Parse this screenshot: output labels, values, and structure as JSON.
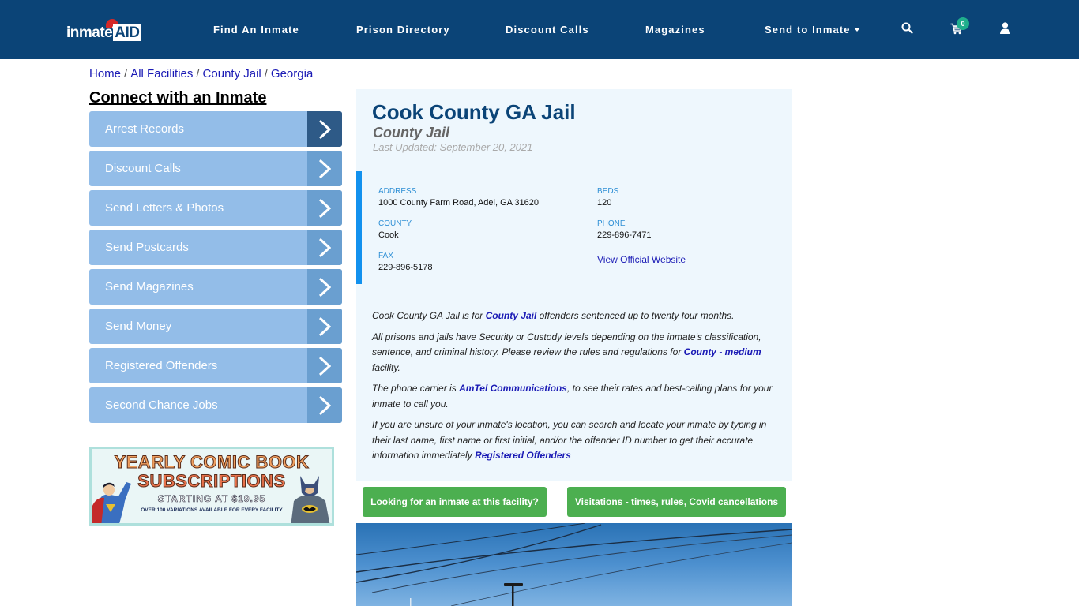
{
  "header": {
    "logo": {
      "prefix": "inmate",
      "suffix": "AID"
    },
    "nav": [
      {
        "label": "Find An Inmate"
      },
      {
        "label": "Prison Directory"
      },
      {
        "label": "Discount Calls"
      },
      {
        "label": "Magazines"
      },
      {
        "label": "Send to Inmate",
        "has_dropdown": true
      }
    ],
    "icons": {
      "search": "search-icon",
      "cart": "cart-icon",
      "user": "user-icon"
    },
    "cart_count": "0"
  },
  "breadcrumb": [
    {
      "label": "Home"
    },
    {
      "label": "All Facilities"
    },
    {
      "label": "County Jail"
    },
    {
      "label": "Georgia"
    }
  ],
  "breadcrumb_separator": "/",
  "sidebar": {
    "title": "Connect with an Inmate",
    "items": [
      {
        "label": "Arrest Records",
        "active": true
      },
      {
        "label": "Discount Calls"
      },
      {
        "label": "Send Letters & Photos"
      },
      {
        "label": "Send Postcards"
      },
      {
        "label": "Send Magazines"
      },
      {
        "label": "Send Money"
      },
      {
        "label": "Registered Offenders"
      },
      {
        "label": "Second Chance Jobs"
      }
    ],
    "ad": {
      "line1": "YEARLY COMIC BOOK",
      "line2": "SUBSCRIPTIONS",
      "line3": "STARTING AT $19.95",
      "line4": "OVER 100 VARIATIONS AVAILABLE FOR EVERY FACILITY"
    }
  },
  "facility": {
    "name": "Cook County GA Jail",
    "type": "County Jail",
    "last_updated": "Last Updated: September 20, 2021",
    "info": {
      "address_label": "ADDRESS",
      "address": "1000 County Farm Road, Adel, GA 31620",
      "beds_label": "BEDS",
      "beds": "120",
      "county_label": "COUNTY",
      "county": "Cook",
      "phone_label": "PHONE",
      "phone": "229-896-7471",
      "fax_label": "FAX",
      "fax": "229-896-5178",
      "website_link": "View Official Website"
    },
    "description": {
      "p1_pre": "Cook County GA Jail is for ",
      "p1_link": "County Jail",
      "p1_post": " offenders sentenced up to twenty four months.",
      "p2_pre": "All prisons and jails have Security or Custody levels depending on the inmate's classification, sentence, and criminal history. Please review the rules and regulations for ",
      "p2_link": "County - medium",
      "p2_post": " facility.",
      "p3_pre": "The phone carrier is ",
      "p3_link": "AmTel Communications",
      "p3_post": ", to see their rates and best-calling plans for your inmate to call you.",
      "p4_pre": "If you are unsure of your inmate's location, you can search and locate your inmate by typing in their last name, first name or first initial, and/or the offender ID number to get their accurate information immediately ",
      "p4_link": "Registered Offenders"
    },
    "buttons": {
      "looking": "Looking for an inmate at this facility?",
      "visitations": "Visitations - times, rules, Covid cancellations"
    }
  },
  "colors": {
    "header_bg": "#0b4477",
    "sidebar_item": "#93bde8",
    "sidebar_arrow": "#6a9fd0",
    "sidebar_arrow_active": "#2e5a87",
    "panel_bg": "#eef7fd",
    "info_accent": "#1291ee",
    "button_green": "#4caf50",
    "link": "#1a1ab5",
    "badge": "#1fae8c"
  }
}
